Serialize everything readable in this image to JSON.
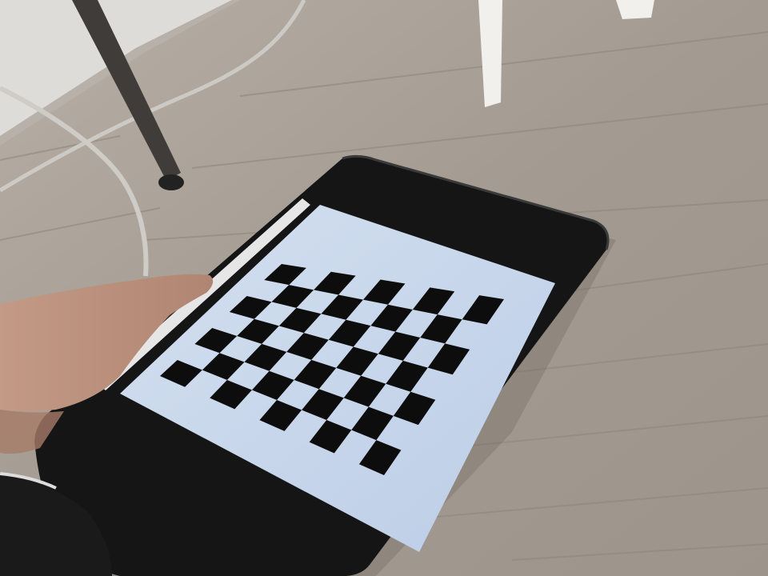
{
  "scene": {
    "description_colors": {
      "floor": "#a59d93",
      "floor_light": "#c9c2b8",
      "floor_dark": "#8a8278",
      "wall": "#dcdad6",
      "tablet_case": "#141414",
      "screen": "#c8d8ec",
      "board_square": "#0d0d0d",
      "skin": "#b98f7a",
      "cable": "#c9c6c2",
      "chair_leg": "#f1efec",
      "desk_leg": "#3d3a37"
    },
    "checkerboard": {
      "rows": 7,
      "cols": 9
    }
  }
}
